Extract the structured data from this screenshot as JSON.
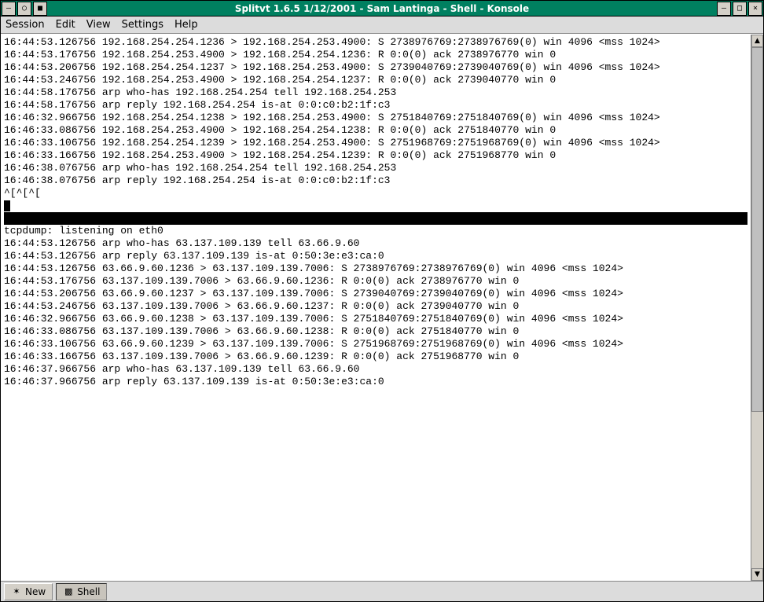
{
  "titlebar": {
    "title": "Splitvt 1.6.5  1/12/2001  - Sam Lantinga - Shell - Konsole",
    "window_menu_icon": "–",
    "pin_icon": "○",
    "all_desktops_icon": "■",
    "minimize_icon": "–",
    "maximize_icon": "□",
    "close_icon": "×"
  },
  "menubar": {
    "session": "Session",
    "edit": "Edit",
    "view": "View",
    "settings": "Settings",
    "help": "Help"
  },
  "scrollbar": {
    "up": "▲",
    "down": "▼"
  },
  "taskbar": {
    "new_label": "New",
    "new_icon": "✶",
    "shell_label": "Shell",
    "shell_icon": "▩"
  },
  "terminal": {
    "top_lines": [
      "16:44:53.126756 192.168.254.254.1236 > 192.168.254.253.4900: S 2738976769:2738976769(0) win 4096 <mss 1024>",
      "16:44:53.176756 192.168.254.253.4900 > 192.168.254.254.1236: R 0:0(0) ack 2738976770 win 0",
      "16:44:53.206756 192.168.254.254.1237 > 192.168.254.253.4900: S 2739040769:2739040769(0) win 4096 <mss 1024>",
      "16:44:53.246756 192.168.254.253.4900 > 192.168.254.254.1237: R 0:0(0) ack 2739040770 win 0",
      "16:44:58.176756 arp who-has 192.168.254.254 tell 192.168.254.253",
      "16:44:58.176756 arp reply 192.168.254.254 is-at 0:0:c0:b2:1f:c3",
      "16:46:32.966756 192.168.254.254.1238 > 192.168.254.253.4900: S 2751840769:2751840769(0) win 4096 <mss 1024>",
      "16:46:33.086756 192.168.254.253.4900 > 192.168.254.254.1238: R 0:0(0) ack 2751840770 win 0",
      "16:46:33.106756 192.168.254.254.1239 > 192.168.254.253.4900: S 2751968769:2751968769(0) win 4096 <mss 1024>",
      "16:46:33.166756 192.168.254.253.4900 > 192.168.254.254.1239: R 0:0(0) ack 2751968770 win 0",
      "16:46:38.076756 arp who-has 192.168.254.254 tell 192.168.254.253",
      "16:46:38.076756 arp reply 192.168.254.254 is-at 0:0:c0:b2:1f:c3",
      "^[^[^["
    ],
    "bottom_header": "tcpdump: listening on eth0",
    "bottom_lines": [
      "16:44:53.126756 arp who-has 63.137.109.139 tell 63.66.9.60",
      "16:44:53.126756 arp reply 63.137.109.139 is-at 0:50:3e:e3:ca:0",
      "16:44:53.126756 63.66.9.60.1236 > 63.137.109.139.7006: S 2738976769:2738976769(0) win 4096 <mss 1024>",
      "16:44:53.176756 63.137.109.139.7006 > 63.66.9.60.1236: R 0:0(0) ack 2738976770 win 0",
      "16:44:53.206756 63.66.9.60.1237 > 63.137.109.139.7006: S 2739040769:2739040769(0) win 4096 <mss 1024>",
      "16:44:53.246756 63.137.109.139.7006 > 63.66.9.60.1237: R 0:0(0) ack 2739040770 win 0",
      "16:46:32.966756 63.66.9.60.1238 > 63.137.109.139.7006: S 2751840769:2751840769(0) win 4096 <mss 1024>",
      "16:46:33.086756 63.137.109.139.7006 > 63.66.9.60.1238: R 0:0(0) ack 2751840770 win 0",
      "16:46:33.106756 63.66.9.60.1239 > 63.137.109.139.7006: S 2751968769:2751968769(0) win 4096 <mss 1024>",
      "16:46:33.166756 63.137.109.139.7006 > 63.66.9.60.1239: R 0:0(0) ack 2751968770 win 0",
      "16:46:37.966756 arp who-has 63.137.109.139 tell 63.66.9.60",
      "16:46:37.966756 arp reply 63.137.109.139 is-at 0:50:3e:e3:ca:0"
    ]
  }
}
